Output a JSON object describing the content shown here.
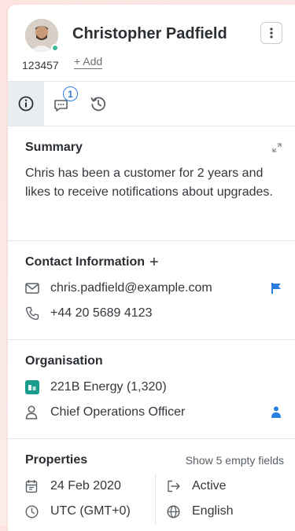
{
  "contact": {
    "name": "Christopher Padfield",
    "id": "123457",
    "add_label": "+ Add"
  },
  "tabs": [
    {
      "name": "info",
      "icon": "info-icon",
      "active": true
    },
    {
      "name": "conversations",
      "icon": "chat-icon",
      "badge": "1"
    },
    {
      "name": "history",
      "icon": "history-icon"
    }
  ],
  "summary": {
    "title": "Summary",
    "text": "Chris has been a customer for 2 years and likes to receive notifications about upgrades."
  },
  "contact_info": {
    "title": "Contact Information",
    "plus": "+",
    "email": "chris.padfield@example.com",
    "phone": "+44 20 5689 4123"
  },
  "organisation": {
    "title": "Organisation",
    "company": "221B Energy (1,320)",
    "role": "Chief Operations Officer"
  },
  "properties": {
    "title": "Properties",
    "empty_fields_label": "Show 5 empty fields",
    "date": "24 Feb 2020",
    "status": "Active",
    "timezone": "UTC (GMT+0)",
    "language": "English"
  },
  "colors": {
    "accent": "#2a7de1",
    "status_online": "#3fb89b",
    "company_logo": "#1a9c8c"
  }
}
